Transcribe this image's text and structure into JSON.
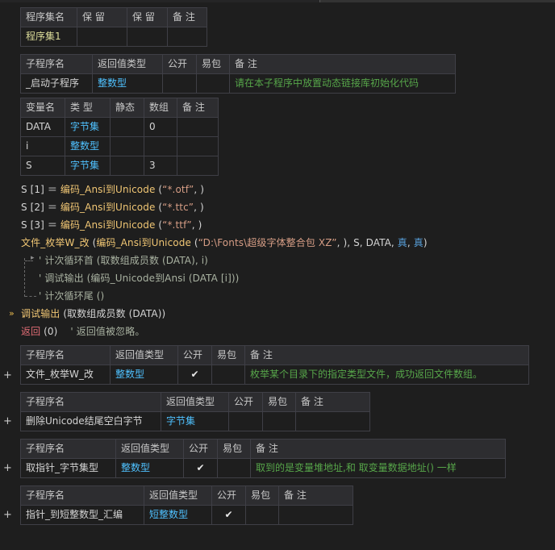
{
  "set_table": {
    "headers": [
      "程序集名",
      "保 留",
      "保 留",
      "备 注"
    ],
    "row": [
      "程序集1",
      "",
      "",
      ""
    ]
  },
  "sub_tables": [
    {
      "headers": [
        "子程序名",
        "返回值类型",
        "公开",
        "易包",
        "备 注"
      ],
      "row": {
        "name": "_启动子程序",
        "ret": "整数型",
        "public": "",
        "easy": "",
        "note": "请在本子程序中放置动态链接库初始化代码"
      }
    },
    {
      "headers": [
        "子程序名",
        "返回值类型",
        "公开",
        "易包",
        "备 注"
      ],
      "row": {
        "name": "文件_枚举W_改",
        "ret": "整数型",
        "public": "✔",
        "easy": "",
        "note": "枚举某个目录下的指定类型文件，成功返回文件数组。"
      }
    },
    {
      "headers": [
        "子程序名",
        "返回值类型",
        "公开",
        "易包",
        "备 注"
      ],
      "row": {
        "name": "删除Unicode结尾空白字节",
        "ret": "字节集",
        "public": "",
        "easy": "",
        "note": ""
      }
    },
    {
      "headers": [
        "子程序名",
        "返回值类型",
        "公开",
        "易包",
        "备 注"
      ],
      "row": {
        "name": "取指针_字节集型",
        "ret": "整数型",
        "public": "✔",
        "easy": "",
        "note": "取到的是变量堆地址,和 取变量数据地址() 一样"
      }
    },
    {
      "headers": [
        "子程序名",
        "返回值类型",
        "公开",
        "易包",
        "备 注"
      ],
      "row": {
        "name": "指针_到短整数型_汇编",
        "ret": "短整数型",
        "public": "✔",
        "easy": "",
        "note": ""
      }
    }
  ],
  "var_table": {
    "headers": [
      "变量名",
      "类 型",
      "静态",
      "数组",
      "备 注"
    ],
    "rows": [
      {
        "name": "DATA",
        "type": "字节集",
        "static": "",
        "array": "0",
        "note": ""
      },
      {
        "name": "i",
        "type": "整数型",
        "static": "",
        "array": "",
        "note": ""
      },
      {
        "name": "S",
        "type": "字节集",
        "static": "",
        "array": "3",
        "note": ""
      }
    ]
  },
  "code": {
    "l1": {
      "a": "S [1] ＝ ",
      "f": "编码_Ansi到Unicode",
      "b": " (",
      "s": "“*.otf”",
      "c": ", )"
    },
    "l2": {
      "a": "S [2] ＝ ",
      "f": "编码_Ansi到Unicode",
      "b": " (",
      "s": "“*.ttc”",
      "c": ", )"
    },
    "l3": {
      "a": "S [3] ＝ ",
      "f": "编码_Ansi到Unicode",
      "b": " (",
      "s": "“*.ttf”",
      "c": ", )"
    },
    "l4": {
      "f": "文件_枚举W_改",
      "b": " (",
      "f2": "编码_Ansi到Unicode",
      "b2": " (",
      "s": "“D:\\Fonts\\超级字体整合包 XZ”",
      "c": ", ), S, DATA, ",
      "t1": "真",
      "sep": ", ",
      "t2": "真",
      "end": ")"
    },
    "l5": "' 计次循环首 (取数组成员数 (DATA), i)",
    "l6": "' 调试输出 (编码_Unicode到Ansi (DATA [i]))",
    "l7": "' 计次循环尾 ()",
    "l8": {
      "f": "调试输出",
      "rest": " (取数组成员数 (DATA))"
    },
    "l9": {
      "kw": "返回",
      "rest": " (0)",
      "com": "' 返回值被忽略。"
    }
  },
  "icons": {
    "plus": "+",
    "arrow": "»"
  }
}
